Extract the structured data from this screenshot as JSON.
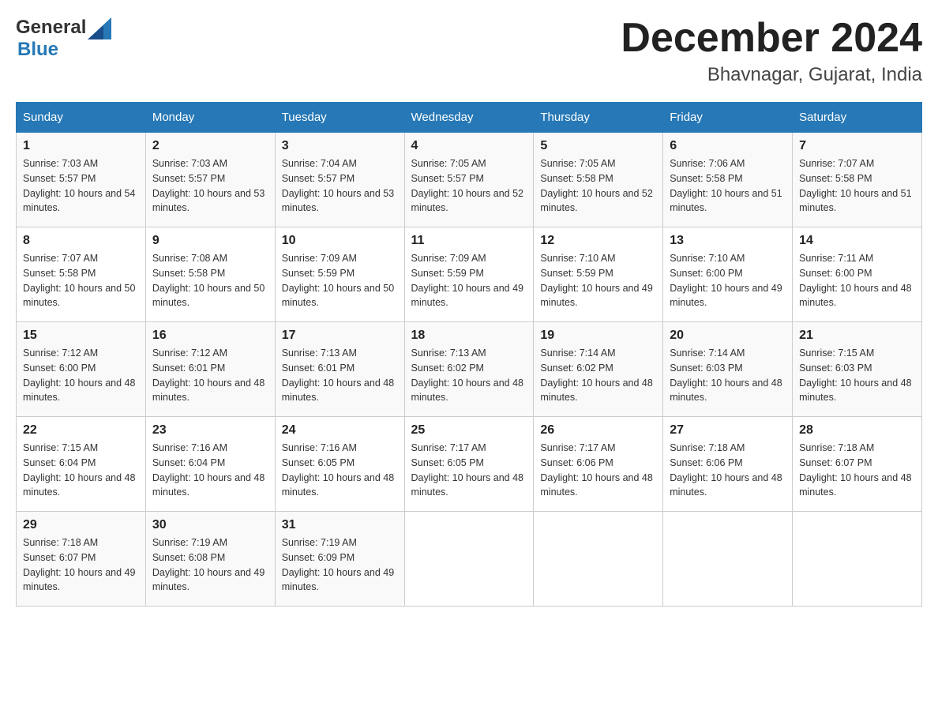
{
  "header": {
    "logo_text_general": "General",
    "logo_text_blue": "Blue",
    "month_year": "December 2024",
    "location": "Bhavnagar, Gujarat, India"
  },
  "days_of_week": [
    "Sunday",
    "Monday",
    "Tuesday",
    "Wednesday",
    "Thursday",
    "Friday",
    "Saturday"
  ],
  "weeks": [
    [
      {
        "day": "1",
        "sunrise": "7:03 AM",
        "sunset": "5:57 PM",
        "daylight": "10 hours and 54 minutes."
      },
      {
        "day": "2",
        "sunrise": "7:03 AM",
        "sunset": "5:57 PM",
        "daylight": "10 hours and 53 minutes."
      },
      {
        "day": "3",
        "sunrise": "7:04 AM",
        "sunset": "5:57 PM",
        "daylight": "10 hours and 53 minutes."
      },
      {
        "day": "4",
        "sunrise": "7:05 AM",
        "sunset": "5:57 PM",
        "daylight": "10 hours and 52 minutes."
      },
      {
        "day": "5",
        "sunrise": "7:05 AM",
        "sunset": "5:58 PM",
        "daylight": "10 hours and 52 minutes."
      },
      {
        "day": "6",
        "sunrise": "7:06 AM",
        "sunset": "5:58 PM",
        "daylight": "10 hours and 51 minutes."
      },
      {
        "day": "7",
        "sunrise": "7:07 AM",
        "sunset": "5:58 PM",
        "daylight": "10 hours and 51 minutes."
      }
    ],
    [
      {
        "day": "8",
        "sunrise": "7:07 AM",
        "sunset": "5:58 PM",
        "daylight": "10 hours and 50 minutes."
      },
      {
        "day": "9",
        "sunrise": "7:08 AM",
        "sunset": "5:58 PM",
        "daylight": "10 hours and 50 minutes."
      },
      {
        "day": "10",
        "sunrise": "7:09 AM",
        "sunset": "5:59 PM",
        "daylight": "10 hours and 50 minutes."
      },
      {
        "day": "11",
        "sunrise": "7:09 AM",
        "sunset": "5:59 PM",
        "daylight": "10 hours and 49 minutes."
      },
      {
        "day": "12",
        "sunrise": "7:10 AM",
        "sunset": "5:59 PM",
        "daylight": "10 hours and 49 minutes."
      },
      {
        "day": "13",
        "sunrise": "7:10 AM",
        "sunset": "6:00 PM",
        "daylight": "10 hours and 49 minutes."
      },
      {
        "day": "14",
        "sunrise": "7:11 AM",
        "sunset": "6:00 PM",
        "daylight": "10 hours and 48 minutes."
      }
    ],
    [
      {
        "day": "15",
        "sunrise": "7:12 AM",
        "sunset": "6:00 PM",
        "daylight": "10 hours and 48 minutes."
      },
      {
        "day": "16",
        "sunrise": "7:12 AM",
        "sunset": "6:01 PM",
        "daylight": "10 hours and 48 minutes."
      },
      {
        "day": "17",
        "sunrise": "7:13 AM",
        "sunset": "6:01 PM",
        "daylight": "10 hours and 48 minutes."
      },
      {
        "day": "18",
        "sunrise": "7:13 AM",
        "sunset": "6:02 PM",
        "daylight": "10 hours and 48 minutes."
      },
      {
        "day": "19",
        "sunrise": "7:14 AM",
        "sunset": "6:02 PM",
        "daylight": "10 hours and 48 minutes."
      },
      {
        "day": "20",
        "sunrise": "7:14 AM",
        "sunset": "6:03 PM",
        "daylight": "10 hours and 48 minutes."
      },
      {
        "day": "21",
        "sunrise": "7:15 AM",
        "sunset": "6:03 PM",
        "daylight": "10 hours and 48 minutes."
      }
    ],
    [
      {
        "day": "22",
        "sunrise": "7:15 AM",
        "sunset": "6:04 PM",
        "daylight": "10 hours and 48 minutes."
      },
      {
        "day": "23",
        "sunrise": "7:16 AM",
        "sunset": "6:04 PM",
        "daylight": "10 hours and 48 minutes."
      },
      {
        "day": "24",
        "sunrise": "7:16 AM",
        "sunset": "6:05 PM",
        "daylight": "10 hours and 48 minutes."
      },
      {
        "day": "25",
        "sunrise": "7:17 AM",
        "sunset": "6:05 PM",
        "daylight": "10 hours and 48 minutes."
      },
      {
        "day": "26",
        "sunrise": "7:17 AM",
        "sunset": "6:06 PM",
        "daylight": "10 hours and 48 minutes."
      },
      {
        "day": "27",
        "sunrise": "7:18 AM",
        "sunset": "6:06 PM",
        "daylight": "10 hours and 48 minutes."
      },
      {
        "day": "28",
        "sunrise": "7:18 AM",
        "sunset": "6:07 PM",
        "daylight": "10 hours and 48 minutes."
      }
    ],
    [
      {
        "day": "29",
        "sunrise": "7:18 AM",
        "sunset": "6:07 PM",
        "daylight": "10 hours and 49 minutes."
      },
      {
        "day": "30",
        "sunrise": "7:19 AM",
        "sunset": "6:08 PM",
        "daylight": "10 hours and 49 minutes."
      },
      {
        "day": "31",
        "sunrise": "7:19 AM",
        "sunset": "6:09 PM",
        "daylight": "10 hours and 49 minutes."
      },
      null,
      null,
      null,
      null
    ]
  ],
  "labels": {
    "sunrise": "Sunrise:",
    "sunset": "Sunset:",
    "daylight": "Daylight:"
  }
}
